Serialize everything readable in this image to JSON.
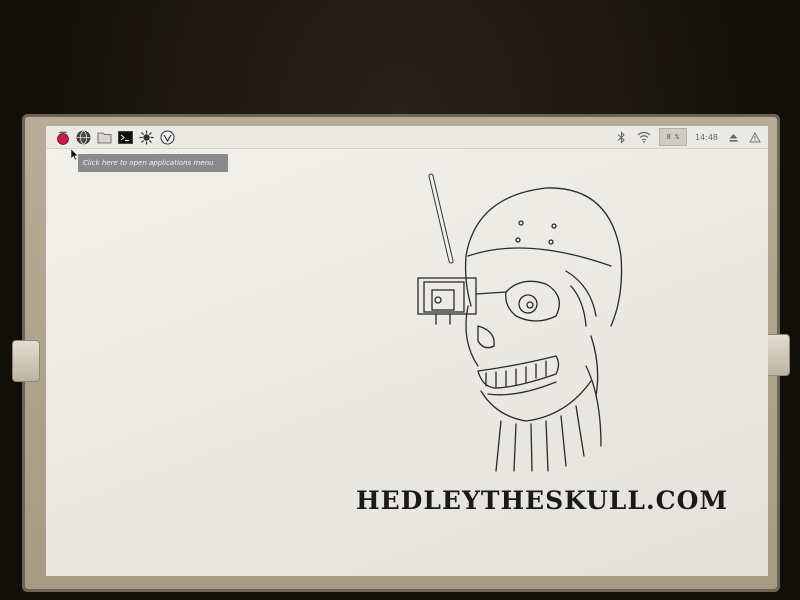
{
  "taskbar": {
    "launchers": [
      {
        "name": "raspberry-menu-icon"
      },
      {
        "name": "web-browser-icon"
      },
      {
        "name": "file-manager-icon"
      },
      {
        "name": "terminal-icon"
      },
      {
        "name": "sunburst-icon"
      },
      {
        "name": "wolfram-icon"
      }
    ],
    "tray": {
      "bluetooth_icon": "bluetooth-icon",
      "wifi_icon": "wifi-icon",
      "cpu_label": "8 %",
      "clock": "14:48",
      "eject_icon": "eject-icon",
      "alert_icon": "alert-icon"
    }
  },
  "tooltip": {
    "text": "Click here to open applications menu"
  },
  "wallpaper": {
    "website": "HEDLEYTHESKULL.COM"
  },
  "colors": {
    "panel_bg": "#ebe9e4",
    "desktop_bg": "#eeece6",
    "tooltip_bg": "#8a8a8a",
    "ink": "#1a1a1a"
  }
}
